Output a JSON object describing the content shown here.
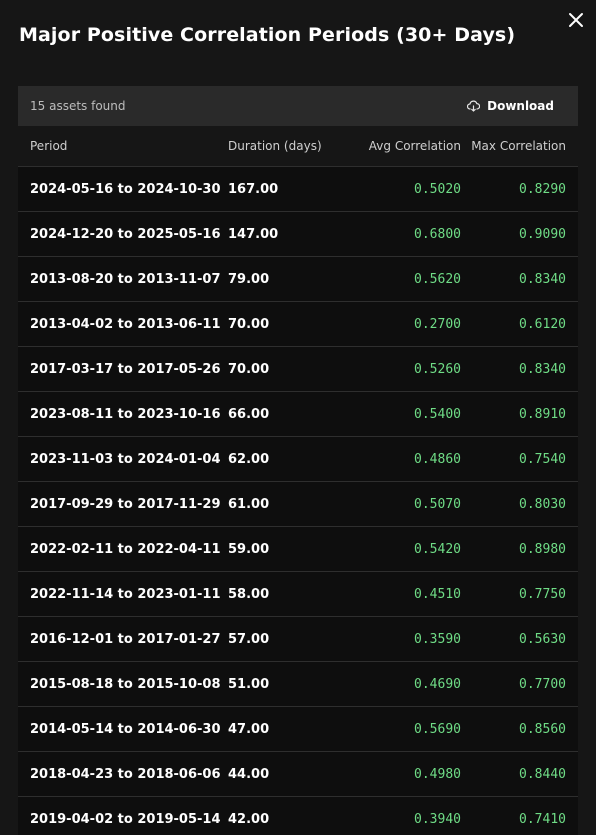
{
  "modal": {
    "title": "Major Positive Correlation Periods (30+ Days)"
  },
  "toolbar": {
    "count_text": "15 assets found",
    "download_label": "Download"
  },
  "colors": {
    "positive_value": "#6fdc86"
  },
  "table": {
    "headers": [
      "Period",
      "Duration (days)",
      "Avg Correlation",
      "Max Correlation"
    ],
    "rows": [
      {
        "period": "2024-05-16 to 2024-10-30",
        "duration": "167.00",
        "avg": "0.5020",
        "max": "0.8290"
      },
      {
        "period": "2024-12-20 to 2025-05-16",
        "duration": "147.00",
        "avg": "0.6800",
        "max": "0.9090"
      },
      {
        "period": "2013-08-20 to 2013-11-07",
        "duration": "79.00",
        "avg": "0.5620",
        "max": "0.8340"
      },
      {
        "period": "2013-04-02 to 2013-06-11",
        "duration": "70.00",
        "avg": "0.2700",
        "max": "0.6120"
      },
      {
        "period": "2017-03-17 to 2017-05-26",
        "duration": "70.00",
        "avg": "0.5260",
        "max": "0.8340"
      },
      {
        "period": "2023-08-11 to 2023-10-16",
        "duration": "66.00",
        "avg": "0.5400",
        "max": "0.8910"
      },
      {
        "period": "2023-11-03 to 2024-01-04",
        "duration": "62.00",
        "avg": "0.4860",
        "max": "0.7540"
      },
      {
        "period": "2017-09-29 to 2017-11-29",
        "duration": "61.00",
        "avg": "0.5070",
        "max": "0.8030"
      },
      {
        "period": "2022-02-11 to 2022-04-11",
        "duration": "59.00",
        "avg": "0.5420",
        "max": "0.8980"
      },
      {
        "period": "2022-11-14 to 2023-01-11",
        "duration": "58.00",
        "avg": "0.4510",
        "max": "0.7750"
      },
      {
        "period": "2016-12-01 to 2017-01-27",
        "duration": "57.00",
        "avg": "0.3590",
        "max": "0.5630"
      },
      {
        "period": "2015-08-18 to 2015-10-08",
        "duration": "51.00",
        "avg": "0.4690",
        "max": "0.7700"
      },
      {
        "period": "2014-05-14 to 2014-06-30",
        "duration": "47.00",
        "avg": "0.5690",
        "max": "0.8560"
      },
      {
        "period": "2018-04-23 to 2018-06-06",
        "duration": "44.00",
        "avg": "0.4980",
        "max": "0.8440"
      },
      {
        "period": "2019-04-02 to 2019-05-14",
        "duration": "42.00",
        "avg": "0.3940",
        "max": "0.7410"
      }
    ]
  }
}
